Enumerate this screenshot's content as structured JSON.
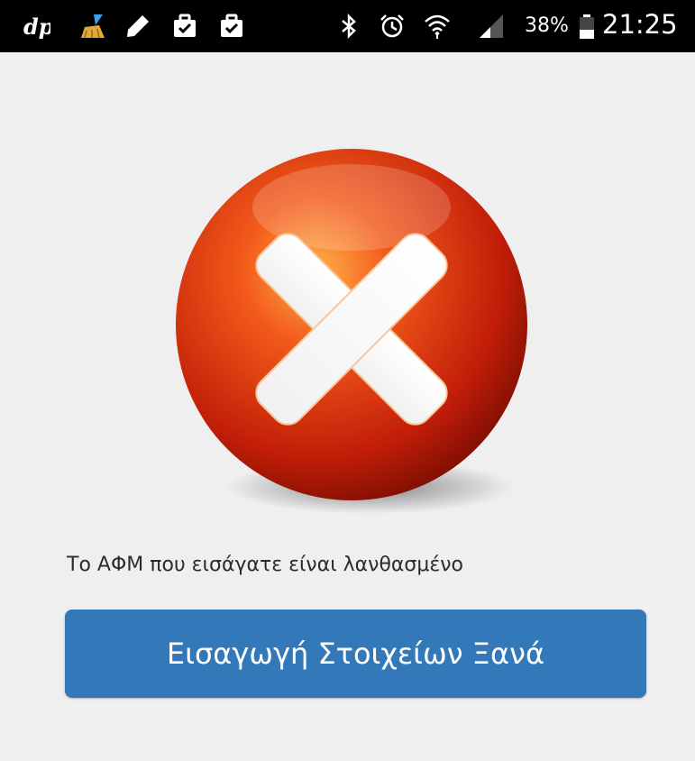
{
  "status_bar": {
    "notification_icons": [
      "dp-app-icon",
      "broom-icon",
      "pencil-icon",
      "briefcase-check-icon",
      "briefcase-check-icon"
    ],
    "system_icons": [
      "bluetooth-icon",
      "alarm-icon",
      "wifi-icon",
      "signal-icon",
      "battery-icon"
    ],
    "battery_percent": "38%",
    "time": "21:25"
  },
  "error": {
    "icon": "error-x-icon",
    "accent_color": "#e8421a",
    "message": "Το ΑΦΜ που εισάγατε είναι λανθασμένο"
  },
  "retry_button": {
    "label": "Εισαγωγή Στοιχείων Ξανά",
    "color": "#3379ba"
  }
}
